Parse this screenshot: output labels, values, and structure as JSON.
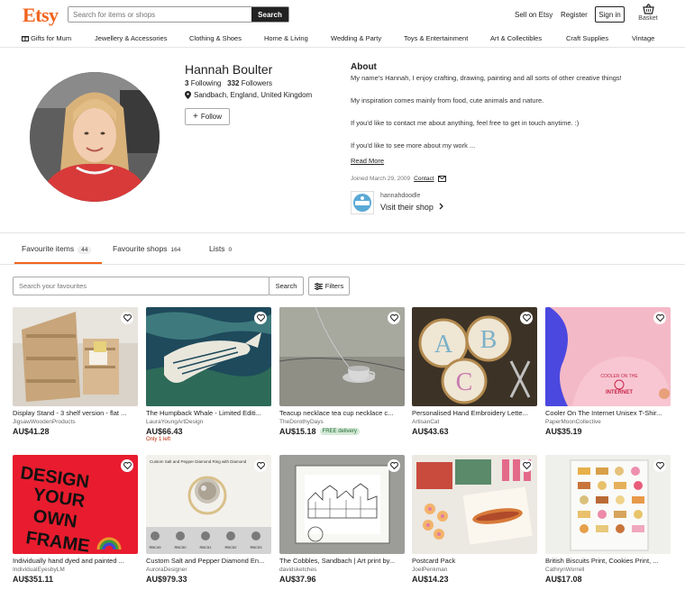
{
  "header": {
    "logo": "Etsy",
    "search_placeholder": "Search for items or shops",
    "search_button": "Search",
    "sell_link": "Sell on Etsy",
    "register_link": "Register",
    "signin_button": "Sign in",
    "basket_label": "Basket",
    "accent_color": "#f1641e"
  },
  "categories": [
    "Gifts for Mum",
    "Jewellery & Accessories",
    "Clothing & Shoes",
    "Home & Living",
    "Wedding & Party",
    "Toys & Entertainment",
    "Art & Collectibles",
    "Craft Supplies",
    "Vintage"
  ],
  "profile": {
    "name": "Hannah Boulter",
    "following_count": "3",
    "following_label": "Following",
    "followers_count": "332",
    "followers_label": "Followers",
    "location": "Sandbach, England, United Kingdom",
    "follow_button": "Follow"
  },
  "about": {
    "heading": "About",
    "paragraphs": [
      "My name's Hannah, I enjoy crafting, drawing, painting and all sorts of other creative things!",
      "My inspiration comes mainly from food, cute animals and nature.",
      "If you'd like to contact me about anything, feel free to get in touch anytime. :)",
      "If you'd like to see more about my work ..."
    ],
    "read_more": "Read More",
    "joined": "Joined March 29, 2009",
    "contact": "Contact",
    "shop_name": "hannahdoodle",
    "visit_shop": "Visit their shop"
  },
  "tabs": [
    {
      "label": "Favourite items",
      "count": "44"
    },
    {
      "label": "Favourite shops",
      "count": "164"
    },
    {
      "label": "Lists",
      "count": "0"
    }
  ],
  "favourites_search": {
    "placeholder": "Search your favourites",
    "button": "Search",
    "filters": "Filters"
  },
  "items": [
    {
      "title": "Display Stand - 3 shelf version - flat ...",
      "shop": "JigsawWoodenProducts",
      "price": "AU$41.28",
      "badge": "",
      "note": ""
    },
    {
      "title": "The Humpback Whale - Limited Editi...",
      "shop": "LauraYoungArtDesign",
      "price": "AU$66.43",
      "badge": "",
      "note": "Only 1 left"
    },
    {
      "title": "Teacup necklace tea cup necklace c...",
      "shop": "TheDorothyDays",
      "price": "AU$15.18",
      "badge": "FREE delivery",
      "note": ""
    },
    {
      "title": "Personalised Hand Embroidery Lette...",
      "shop": "ArtisanCat",
      "price": "AU$43.63",
      "badge": "",
      "note": ""
    },
    {
      "title": "Cooler On The Internet Unisex T-Shir...",
      "shop": "PaperMoonCollective",
      "price": "AU$35.19",
      "badge": "",
      "note": ""
    },
    {
      "title": "Individually hand dyed and painted ...",
      "shop": "IndividualEyesbyLM",
      "price": "AU$351.11",
      "badge": "",
      "note": ""
    },
    {
      "title": "Custom Salt and Pepper Diamond En...",
      "shop": "AuroraDesigner",
      "price": "AU$979.33",
      "badge": "",
      "note": ""
    },
    {
      "title": "The Cobbles, Sandbach | Art print by...",
      "shop": "davidsketches",
      "price": "AU$37.96",
      "badge": "",
      "note": ""
    },
    {
      "title": "Postcard Pack",
      "shop": "JoelPenkman",
      "price": "AU$14.23",
      "badge": "",
      "note": ""
    },
    {
      "title": "British Biscuits Print, Cookies Print, ...",
      "shop": "CathrynWorrell",
      "price": "AU$17.08",
      "badge": "",
      "note": ""
    }
  ],
  "image_text": {
    "design_frame": [
      "DESIGN",
      "YOUR",
      "OWN",
      "FRAME"
    ],
    "ring_caption": "Custom Salt and Pepper Diamond Ring with Diamond",
    "ring_labels": [
      "RBC49",
      "RBC50",
      "RBC51",
      "RBC52",
      "RBC53"
    ],
    "tshirt_text": [
      "COOLER ON THE",
      "INTERNET"
    ]
  }
}
